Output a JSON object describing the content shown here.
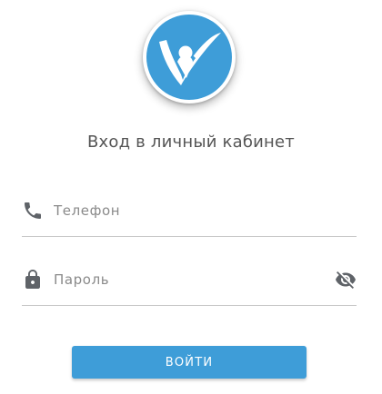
{
  "logo": {
    "icon": "person-check-logo",
    "color": "#3e9dd8"
  },
  "login": {
    "title": "Вход в личный кабинет",
    "phone": {
      "icon": "phone-icon",
      "placeholder": "Телефон",
      "value": ""
    },
    "password": {
      "icon": "lock-icon",
      "placeholder": "Пароль",
      "value": "",
      "toggle_icon": "eye-off-icon"
    },
    "submit_label": "ВОЙТИ"
  },
  "colors": {
    "accent": "#3e9dd8",
    "text": "#555555",
    "placeholder": "#8a8a8a",
    "divider": "#c8c8c8"
  }
}
